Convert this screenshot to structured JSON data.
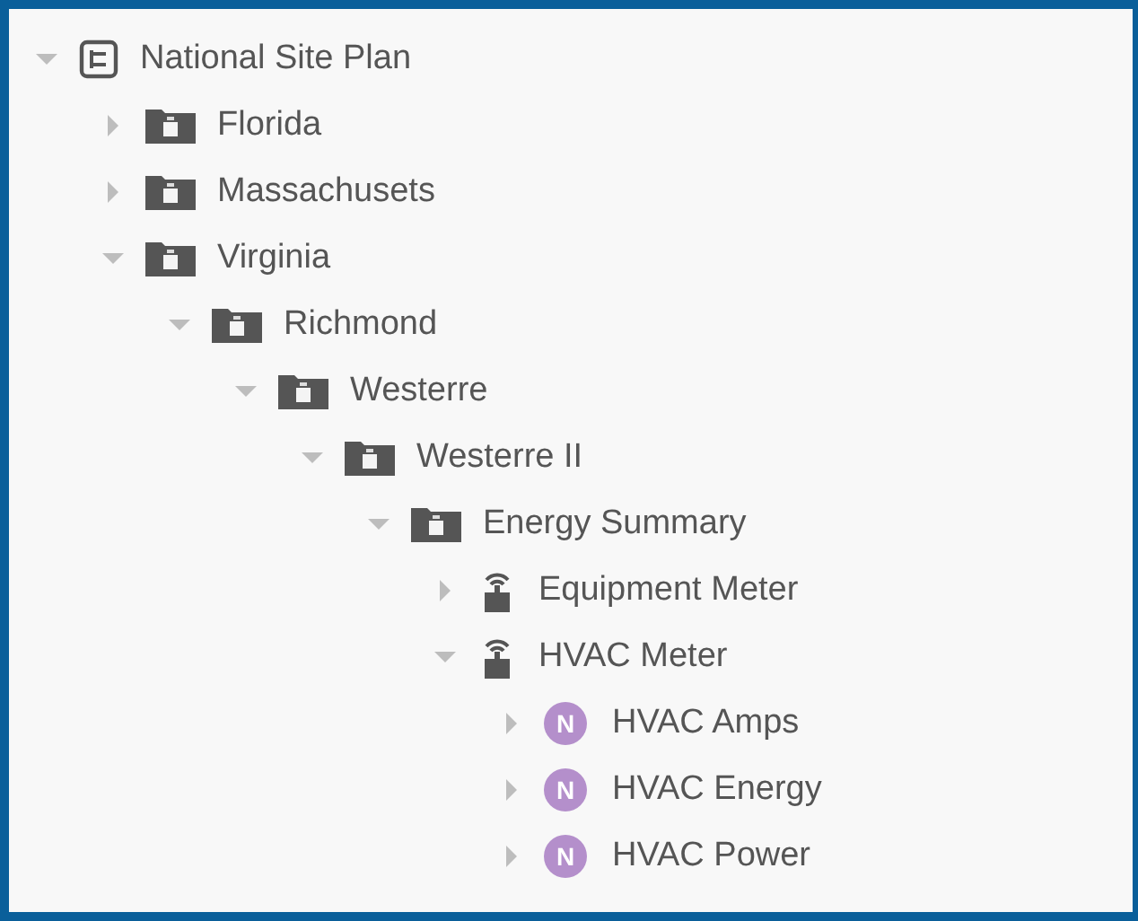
{
  "tree": [
    {
      "label": "National Site Plan",
      "kind": "site",
      "expanded": true,
      "children": [
        {
          "label": "Florida",
          "kind": "folder",
          "expanded": false
        },
        {
          "label": "Massachusets",
          "kind": "folder",
          "expanded": false
        },
        {
          "label": "Virginia",
          "kind": "folder",
          "expanded": true,
          "children": [
            {
              "label": "Richmond",
              "kind": "folder",
              "expanded": true,
              "children": [
                {
                  "label": "Westerre",
                  "kind": "folder",
                  "expanded": true,
                  "children": [
                    {
                      "label": "Westerre II",
                      "kind": "folder",
                      "expanded": true,
                      "children": [
                        {
                          "label": "Energy Summary",
                          "kind": "folder",
                          "expanded": true,
                          "children": [
                            {
                              "label": "Equipment Meter",
                              "kind": "meter",
                              "expanded": false
                            },
                            {
                              "label": "HVAC Meter",
                              "kind": "meter",
                              "expanded": true,
                              "children": [
                                {
                                  "label": "HVAC Amps",
                                  "kind": "point",
                                  "expanded": false,
                                  "badge": "N"
                                },
                                {
                                  "label": "HVAC Energy",
                                  "kind": "point",
                                  "expanded": false,
                                  "badge": "N"
                                },
                                {
                                  "label": "HVAC Power",
                                  "kind": "point",
                                  "expanded": false,
                                  "badge": "N"
                                }
                              ]
                            }
                          ]
                        }
                      ]
                    }
                  ]
                }
              ]
            }
          ]
        }
      ]
    }
  ]
}
